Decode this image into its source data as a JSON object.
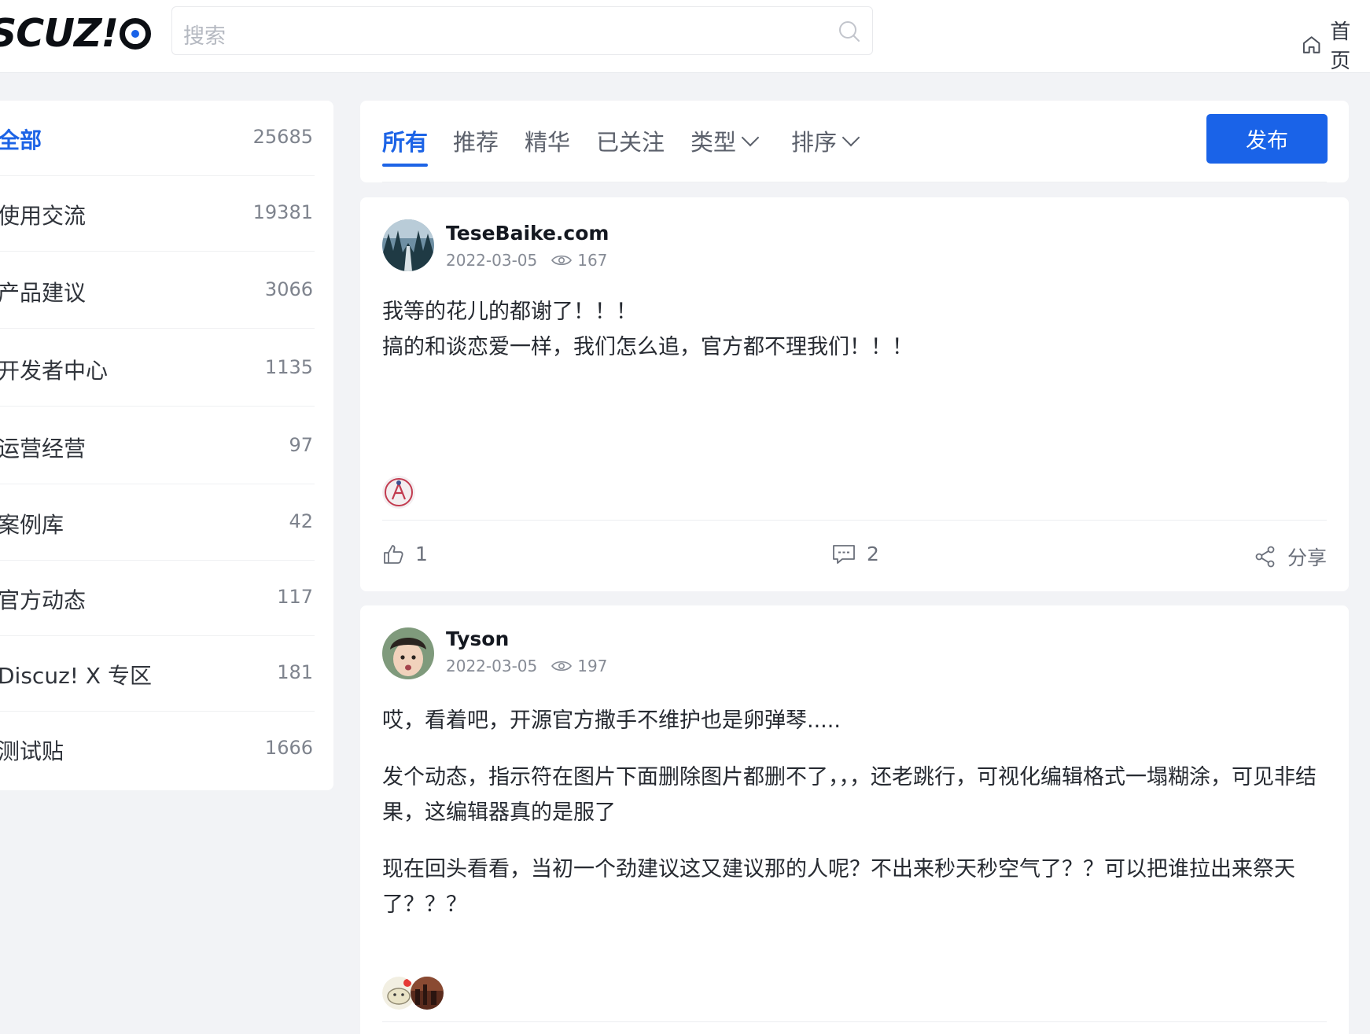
{
  "header": {
    "logo": "SCUZ!",
    "search_placeholder": "搜索",
    "home_label": "首页"
  },
  "sidebar": {
    "items": [
      {
        "label": "全部",
        "count": "25685",
        "active": true
      },
      {
        "label": "使用交流",
        "count": "19381"
      },
      {
        "label": "产品建议",
        "count": "3066"
      },
      {
        "label": "开发者中心",
        "count": "1135"
      },
      {
        "label": "运营经营",
        "count": "97"
      },
      {
        "label": "案例库",
        "count": "42"
      },
      {
        "label": "官方动态",
        "count": "117"
      },
      {
        "label": "Discuz! X 专区",
        "count": "181"
      },
      {
        "label": "测试贴",
        "count": "1666"
      }
    ]
  },
  "tabs": {
    "all": "所有",
    "recommend": "推荐",
    "essence": "精华",
    "following": "已关注",
    "type": "类型",
    "sort": "排序",
    "publish": "发布"
  },
  "posts": [
    {
      "author": "TeseBaike.com",
      "date": "2022-03-05",
      "views": "167",
      "lines": [
        "我等的花儿的都谢了！！！",
        "搞的和谈恋爱一样，我们怎么追，官方都不理我们！！！"
      ],
      "likes": "1",
      "comments": "2",
      "share": "分享"
    },
    {
      "author": "Tyson",
      "date": "2022-03-05",
      "views": "197",
      "paragraphs": [
        "哎，看着吧，开源官方撒手不维护也是卵弹琴.....",
        "发个动态，指示符在图片下面删除图片都删不了，，，还老跳行，可视化编辑格式一塌糊涂，可见非结果，这编辑器真的是服了",
        "现在回头看看，当初一个劲建议这又建议那的人呢？不出来秒天秒空气了？？可以把谁拉出来祭天了？？？"
      ]
    }
  ],
  "colors": {
    "accent": "#1d64e6",
    "publish_button": "#1a63e8",
    "page_bg": "#f2f3f6"
  },
  "icons": [
    "search-icon",
    "home-icon",
    "chevron-down-icon",
    "eye-icon",
    "thumb-up-icon",
    "comment-icon",
    "share-icon"
  ]
}
